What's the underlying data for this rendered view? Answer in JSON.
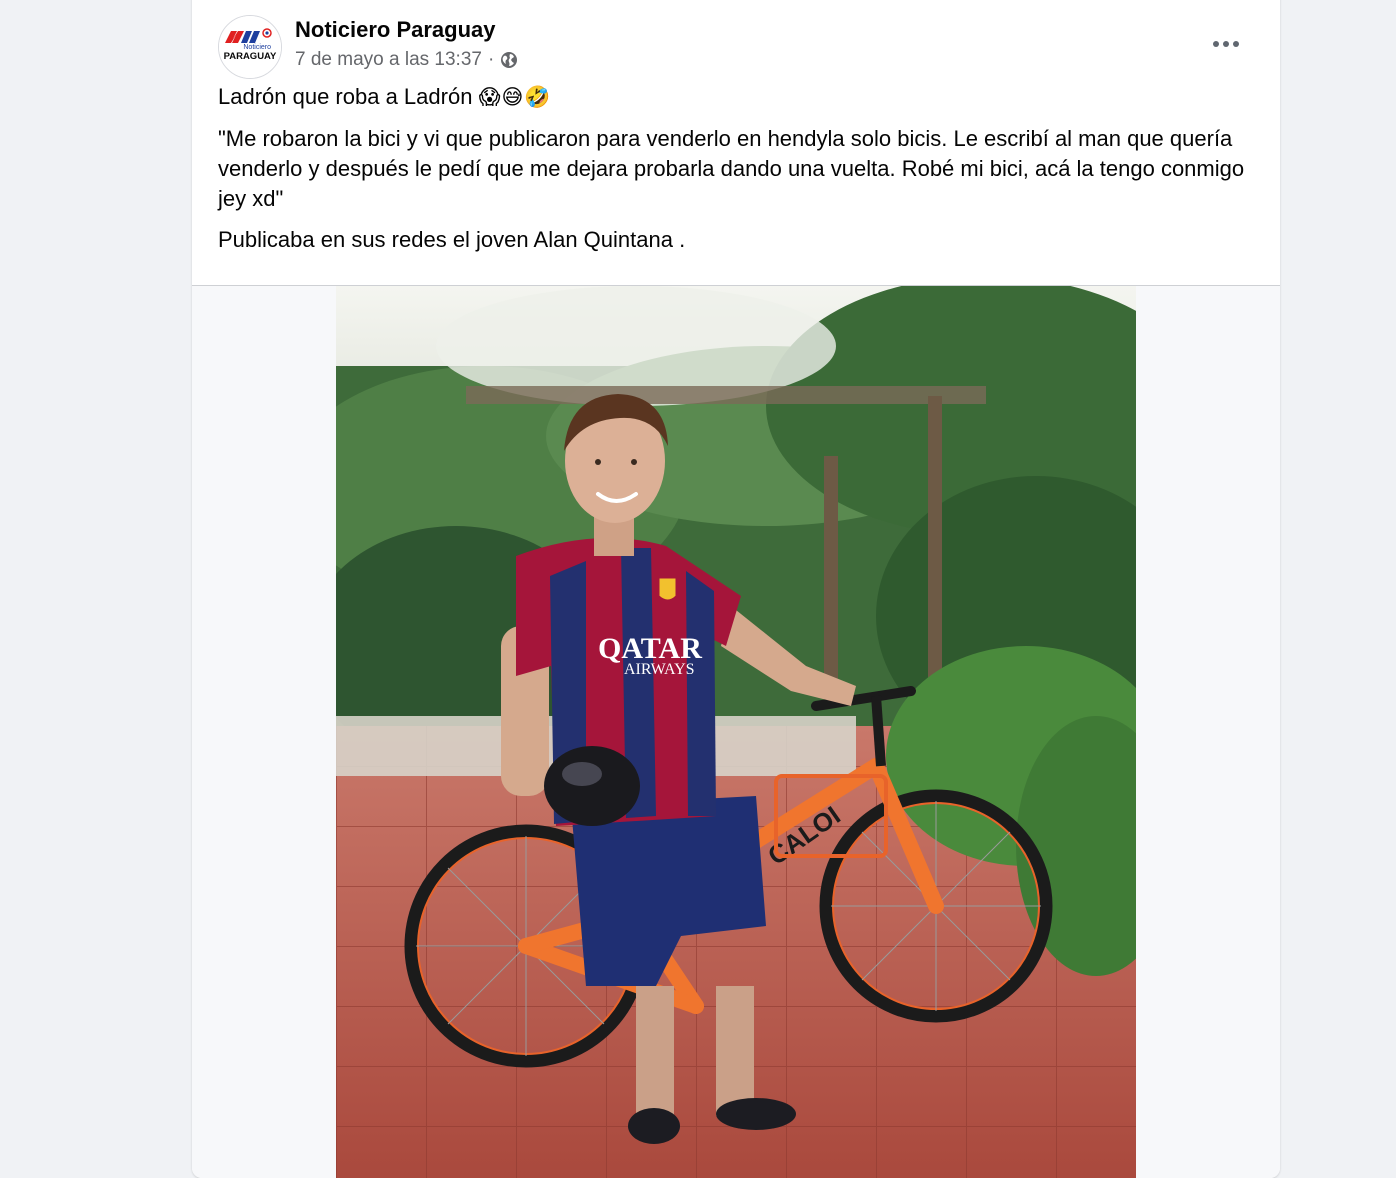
{
  "post": {
    "page_name": "Noticiero Paraguay",
    "timestamp": "7 de mayo a las 13:37",
    "separator": "·",
    "privacy_icon": "globe-icon",
    "more_icon": "more-horizontal-icon",
    "avatar": {
      "logo_text_top": "Noticiero",
      "logo_text_bottom": "PARAGUAY",
      "logo_mark": "NP",
      "colors": {
        "red": "#e02020",
        "blue": "#1e3f9e"
      }
    },
    "text": {
      "line1": "Ladrón que roba a Ladrón",
      "line1_emojis": "😱😅🤣",
      "quote": "\"Me robaron la bici y vi que publicaron para venderlo en hendyla solo bicis. Le escribí al man que quería venderlo y después le pedí que me dejara probarla dando una vuelta. Robé mi bici, acá la tengo conmigo jey xd\"",
      "footer": "Publicaba en sus redes el joven Alan Quintana ."
    },
    "photo": {
      "shirt_text_1": "QATAR",
      "shirt_text_2": "AIRWAYS",
      "bike_brand": "CALOI"
    }
  }
}
